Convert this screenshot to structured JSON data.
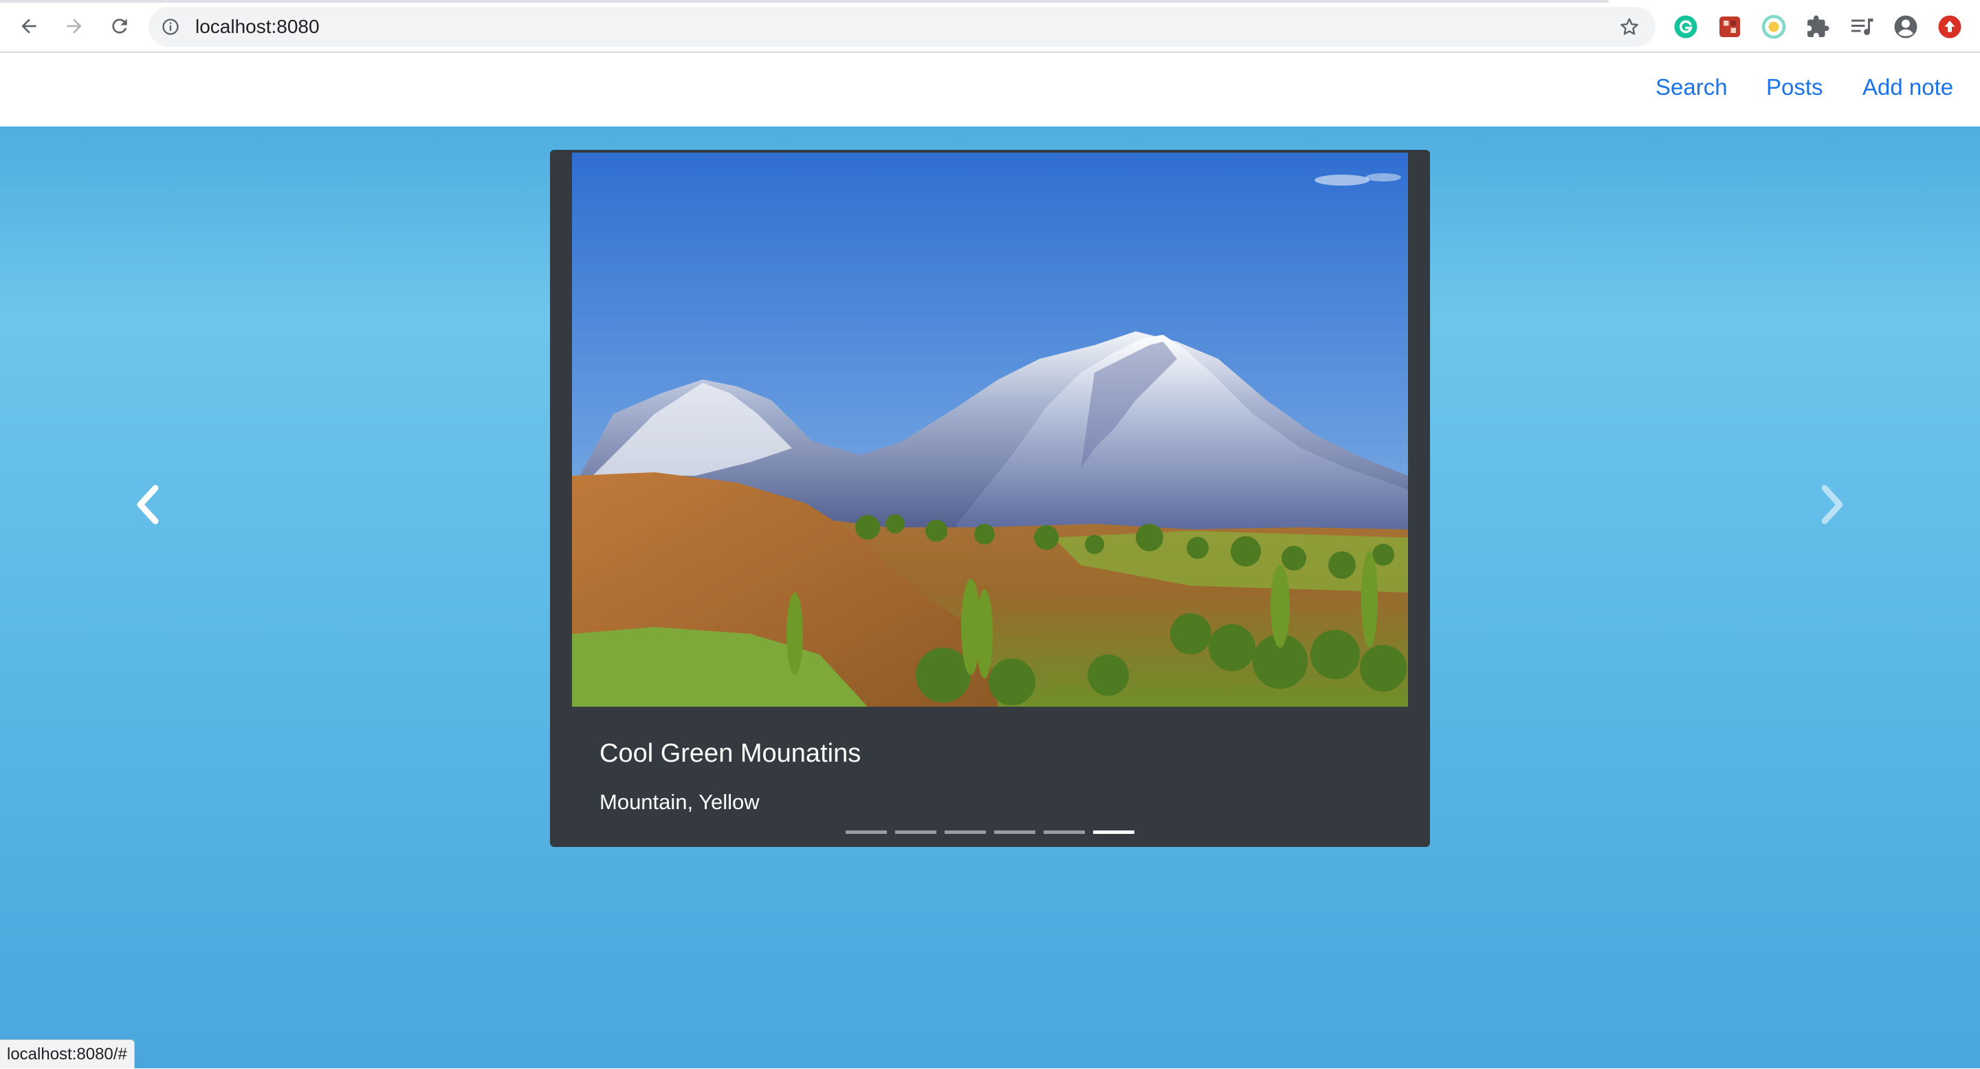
{
  "browser": {
    "url": "localhost:8080",
    "status_url": "localhost:8080/#"
  },
  "nav": {
    "links": [
      {
        "label": "Search"
      },
      {
        "label": "Posts"
      },
      {
        "label": "Add note"
      }
    ]
  },
  "carousel": {
    "slide": {
      "title": "Cool Green Mounatins",
      "tags": "Mountain, Yellow"
    },
    "slide_count": 6,
    "active_index": 5
  },
  "colors": {
    "link": "#1a73e8",
    "card": "#343a40",
    "background": "#5cb8e6"
  },
  "icons": [
    "back-arrow-icon",
    "forward-arrow-icon",
    "reload-icon",
    "info-icon",
    "star-icon",
    "grammarly-icon",
    "extension-icon",
    "puzzle-icon",
    "reading-list-icon",
    "profile-icon",
    "update-icon",
    "chevron-left-icon",
    "chevron-right-icon"
  ]
}
